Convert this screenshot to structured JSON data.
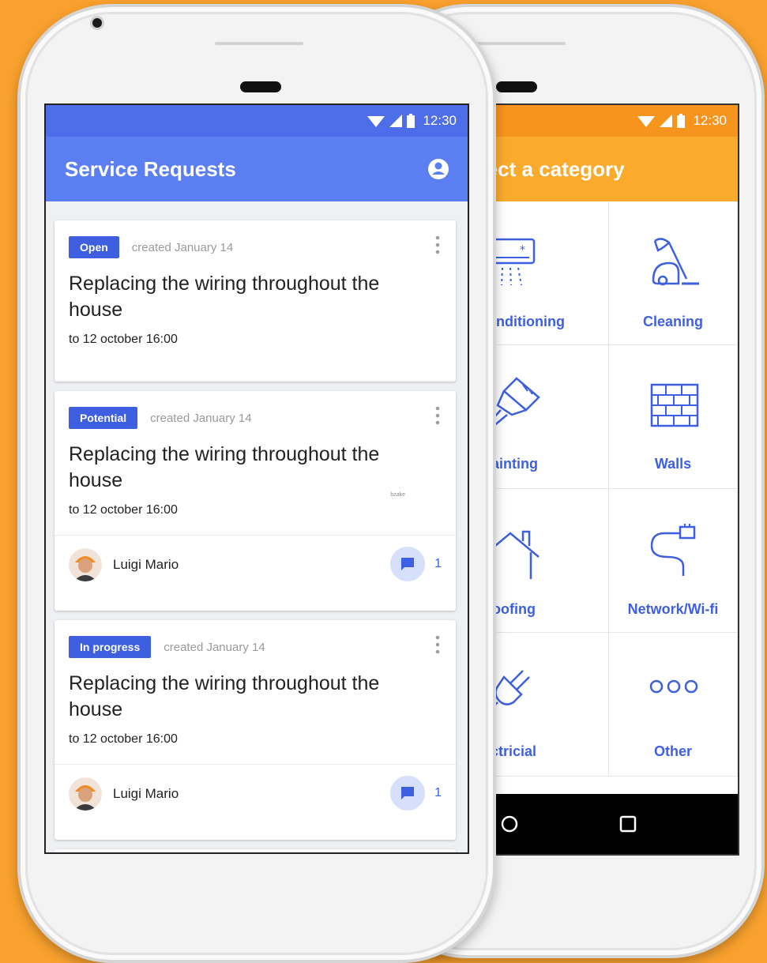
{
  "front_phone": {
    "status_time": "12:30",
    "app_title": "Service Requests",
    "cards": [
      {
        "status": "Open",
        "created": "created January 14",
        "title": "Replacing the wiring throughout the house",
        "due": "to 12 october 16:00"
      },
      {
        "status": "Potential",
        "created": "created January 14",
        "title": "Replacing the wiring throughout the house",
        "due": "to 12 october 16:00",
        "note": "bzake",
        "worker": "Luigi Mario",
        "comments": "1"
      },
      {
        "status": "In progress",
        "created": "created January 14",
        "title": "Replacing the wiring throughout the house",
        "due": "to 12 october 16:00",
        "worker": "Luigi Mario",
        "comments": "1"
      }
    ]
  },
  "back_phone": {
    "status_time": "12:30",
    "header": "elect a category",
    "categories": [
      "Conditioning",
      "Cleaning",
      "Painting",
      "Walls",
      "Roofing",
      "Network/Wi-fi",
      "lectricial",
      "Other"
    ]
  },
  "colors": {
    "background": "#f9a12e",
    "primary_blue": "#5b7ff2",
    "accent_blue": "#3d5fe0",
    "orange_header": "#fbaa2c"
  }
}
